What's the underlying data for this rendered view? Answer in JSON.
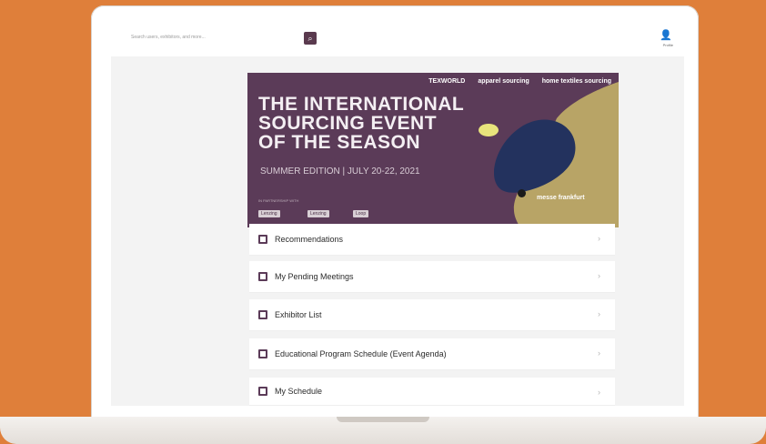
{
  "search": {
    "placeholder": "Search users, exhibitors, and more..."
  },
  "header": {
    "account_label": "Profile"
  },
  "banner": {
    "brands": [
      "TEXWORLD",
      "apparel sourcing",
      "home textiles sourcing"
    ],
    "title_lines": [
      "THE INTERNATIONAL",
      "SOURCING EVENT",
      "OF THE SEASON"
    ],
    "subtitle": "SUMMER EDITION | JULY 20-22, 2021",
    "sponsors_label": "IN PARTNERSHIP WITH",
    "sponsors": [
      "Lenzing",
      "Lenzing",
      "Loop"
    ],
    "organizer": "messe frankfurt"
  },
  "menu": {
    "items": [
      {
        "label": "Recommendations"
      },
      {
        "label": "My Pending Meetings"
      },
      {
        "label": "Exhibitor List"
      },
      {
        "label": "Educational Program Schedule (Event Agenda)"
      },
      {
        "label": "My Schedule"
      }
    ],
    "chevron": "›"
  },
  "colors": {
    "background": "#df7f3a",
    "banner": "#5b3b58",
    "accent_yellow": "#e8e47c",
    "accent_navy": "#23325e",
    "accent_sand": "#b8a466"
  },
  "icons": {
    "search": "search-icon",
    "account": "user-icon",
    "menu_item": "calendar-icon",
    "chevron": "chevron-right-icon"
  }
}
